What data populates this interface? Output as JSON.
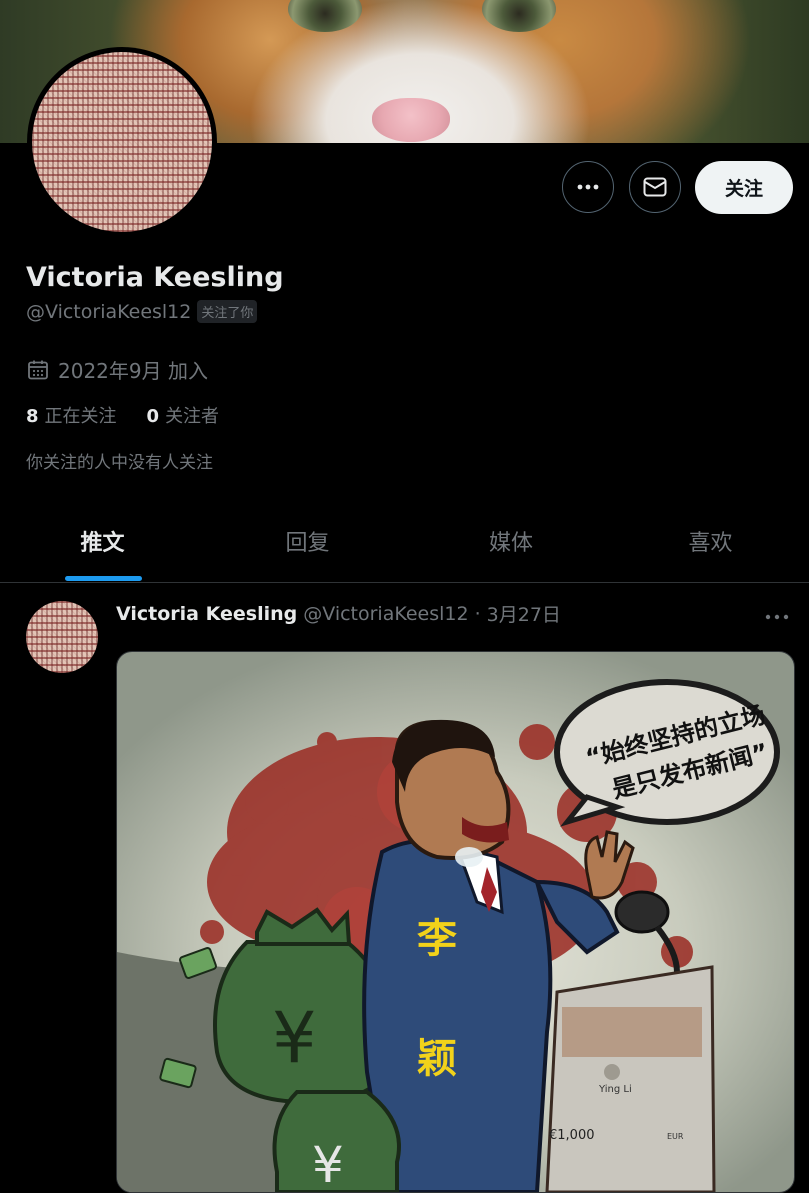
{
  "profile": {
    "name": "Victoria Keesling",
    "handle": "@VictoriaKeesl12",
    "follows_you_badge": "关注了你",
    "joined": "2022年9月 加入",
    "following_count": "8",
    "following_label": "正在关注",
    "followers_count": "0",
    "followers_label": "关注者",
    "mutual_note": "你关注的人中没有人关注",
    "follow_button": "关注"
  },
  "icons": {
    "more": "more-horizontal-icon",
    "message": "envelope-icon",
    "calendar": "calendar-icon"
  },
  "tabs": [
    {
      "label": "推文",
      "active": true
    },
    {
      "label": "回复",
      "active": false
    },
    {
      "label": "媒体",
      "active": false
    },
    {
      "label": "喜欢",
      "active": false
    }
  ],
  "tweet": {
    "author_name": "Victoria Keesling",
    "author_handle": "@VictoriaKeesl12",
    "separator": "·",
    "date": "3月27日",
    "image_text": {
      "speech_bubble_line1": "“始终坚持的立场",
      "speech_bubble_line2": "是只发布新闻”",
      "jacket_char_1": "李",
      "jacket_char_2": "颖",
      "bag_symbol": "¥",
      "screen_name": "Ying Li",
      "screen_price": "€1,000",
      "screen_currency": "EUR"
    }
  },
  "colors": {
    "background": "#000000",
    "text_primary": "#e7e9ea",
    "text_secondary": "#71767b",
    "accent_blue": "#1d9bf0",
    "follow_button_bg": "#eff3f4"
  }
}
